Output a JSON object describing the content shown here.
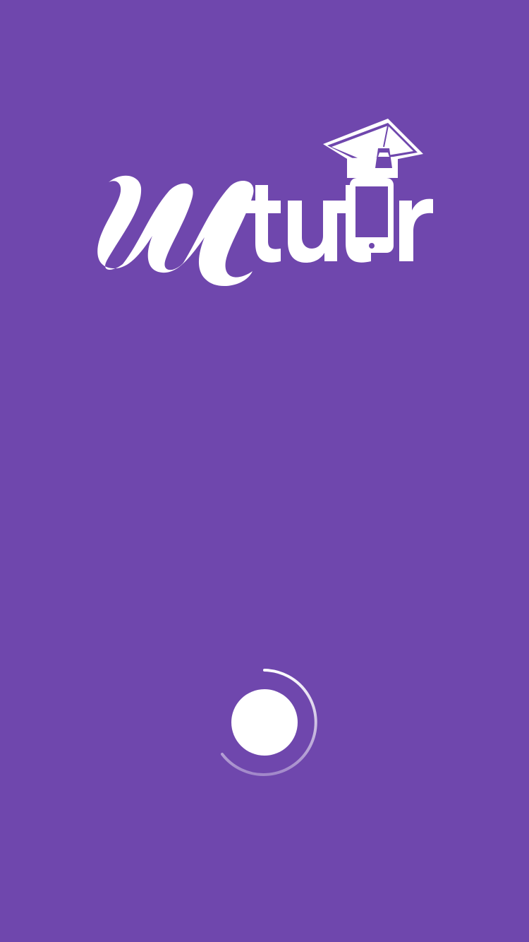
{
  "app": {
    "brand_text": "Mtutr",
    "background_color": "#6f47ad",
    "logo_color": "#ffffff"
  },
  "icons": {
    "logo": "mtutor-logo",
    "cap": "graduation-cap-icon",
    "phone": "smartphone-icon",
    "spinner": "loading-spinner-icon"
  },
  "loader": {
    "state": "loading"
  }
}
